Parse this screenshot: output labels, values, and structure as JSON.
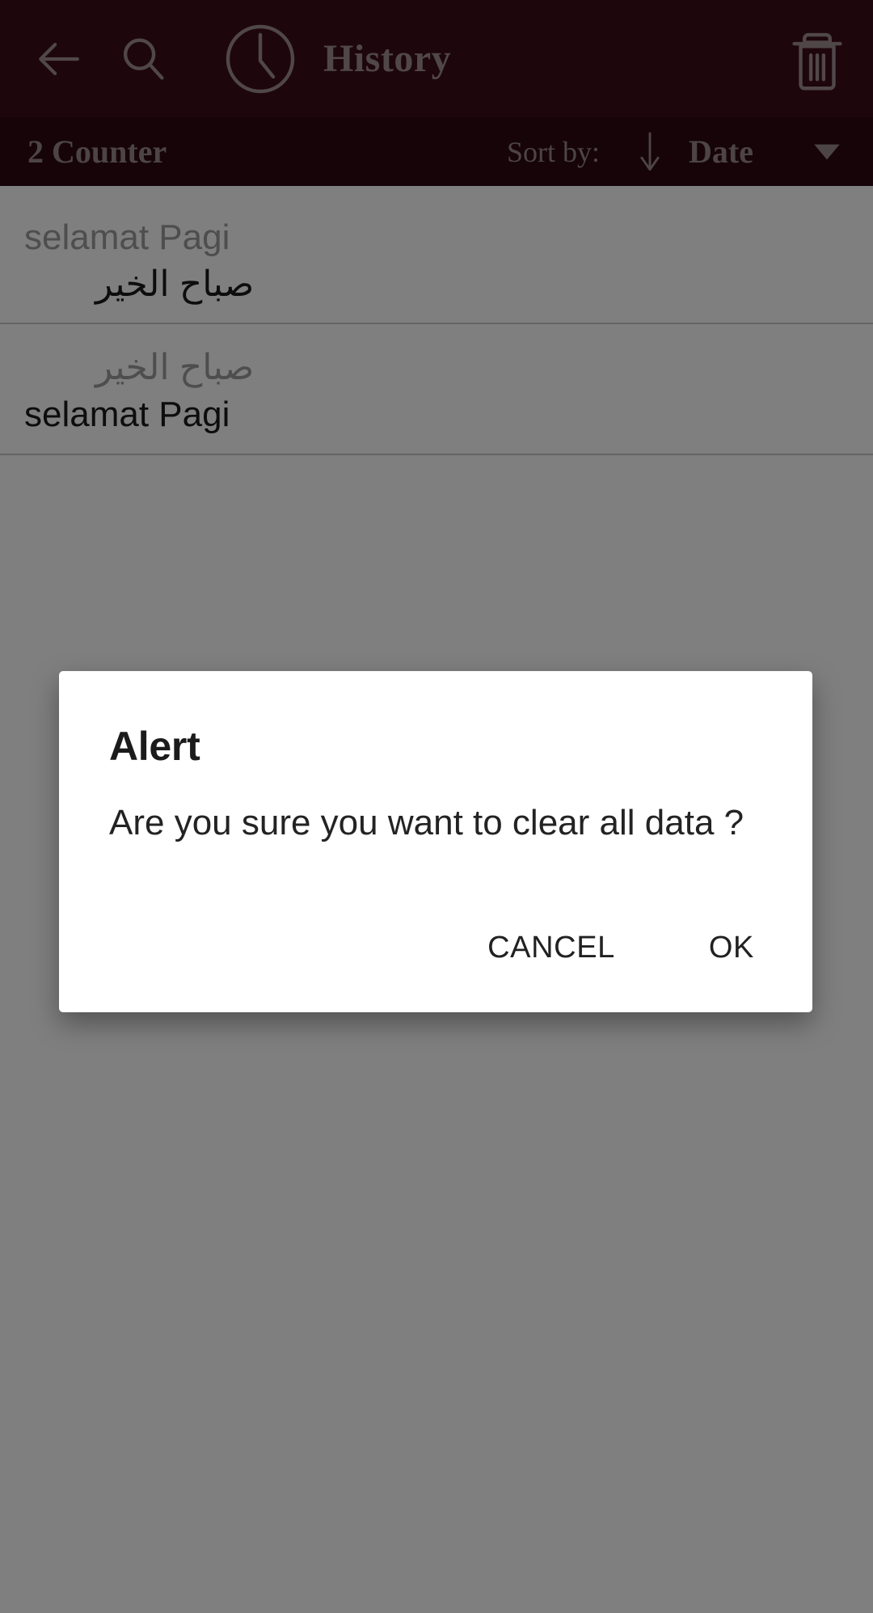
{
  "toolbar": {
    "back_icon": "arrow-left-icon",
    "search_icon": "search-icon",
    "clock_icon": "clock-icon",
    "title": "History",
    "delete_icon": "trash-icon"
  },
  "sortbar": {
    "counter": "2 Counter",
    "sort_by_label": "Sort by:",
    "direction_icon": "arrow-down-icon",
    "sort_value": "Date",
    "dropdown_icon": "caret-down-icon"
  },
  "history": {
    "items": [
      {
        "source": "selamat Pagi",
        "target": "صباح الخير"
      },
      {
        "source": "صباح الخير",
        "target": "selamat Pagi"
      }
    ]
  },
  "dialog": {
    "title": "Alert",
    "message": "Are you sure you want to clear all data ?",
    "cancel_label": "CANCEL",
    "ok_label": "OK"
  },
  "colors": {
    "toolbar_bg": "#3d0c1a",
    "sortbar_bg": "#2d0810",
    "toolbar_fg": "#a08e92",
    "dialog_bg": "#ffffff",
    "scrim": "rgba(0,0,0,0.50)"
  }
}
